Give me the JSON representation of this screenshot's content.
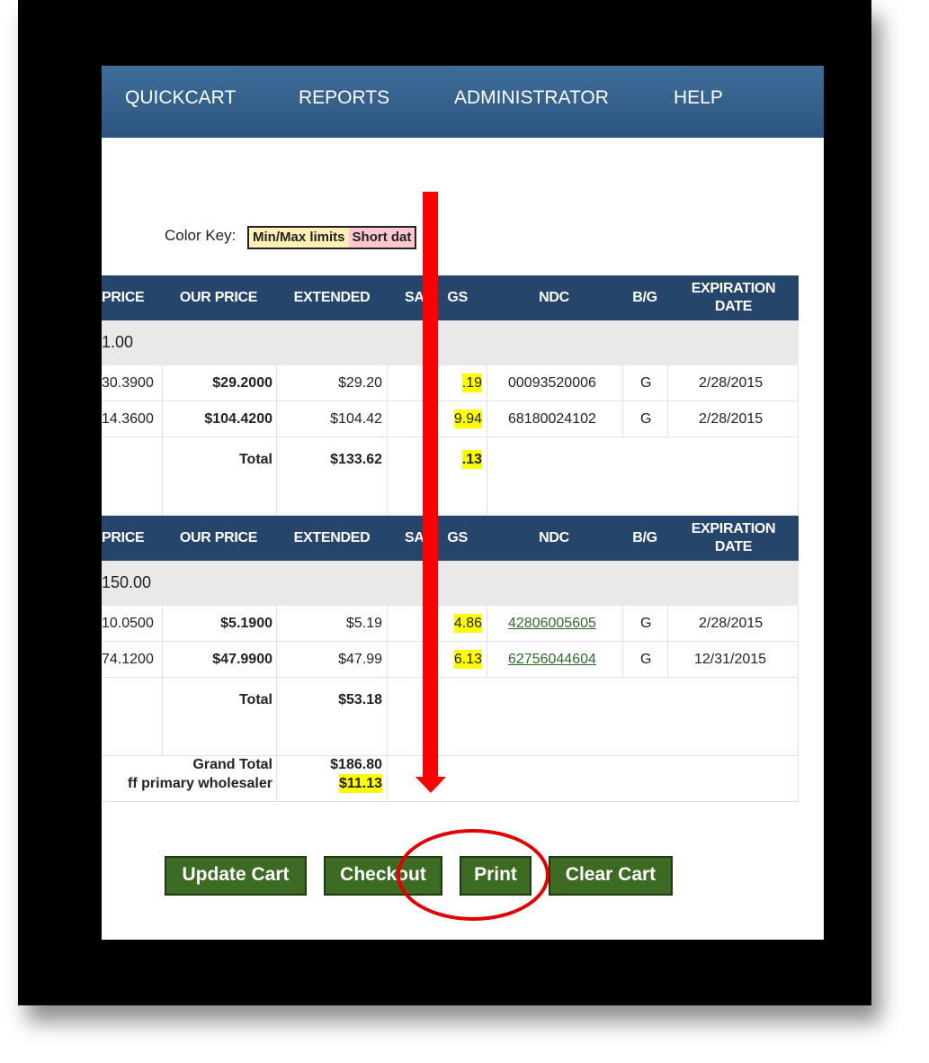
{
  "nav": {
    "items": [
      "QUICKCART",
      "REPORTS",
      "ADMINISTRATOR",
      "HELP"
    ]
  },
  "color_key": {
    "label": "Color Key:",
    "min_max": "Min/Max limits",
    "short_date": "Short dat"
  },
  "columns": {
    "price": "PRICE",
    "our_price": "OUR PRICE",
    "extended": "EXTENDED",
    "savings": "SAVI   GS",
    "ndc": "NDC",
    "bg": "B/G",
    "expiration_line1": "EXPIRATION",
    "expiration_line2": "DATE"
  },
  "sections": [
    {
      "group_value": "1.00",
      "rows": [
        {
          "price": "30.3900",
          "our_price": "$29.2000",
          "extended": "$29.20",
          "savings": ".19",
          "ndc": "00093520006",
          "bg": "G",
          "expiration": "2/28/2015"
        },
        {
          "price": "14.3600",
          "our_price": "$104.4200",
          "extended": "$104.42",
          "savings": "9.94",
          "ndc": "68180024102",
          "bg": "G",
          "expiration": "2/28/2015"
        }
      ],
      "total_label": "Total",
      "total_extended": "$133.62",
      "total_savings": ".13"
    },
    {
      "group_value": "150.00",
      "rows": [
        {
          "price": "10.0500",
          "our_price": "$5.1900",
          "extended": "$5.19",
          "savings": "4.86",
          "ndc": "42806005605",
          "bg": "G",
          "expiration": "2/28/2015"
        },
        {
          "price": "74.1200",
          "our_price": "$47.9900",
          "extended": "$47.99",
          "savings": "6.13",
          "ndc": "62756044604",
          "bg": "G",
          "expiration": "12/31/2015"
        }
      ],
      "total_label": "Total",
      "total_extended": "$53.18"
    }
  ],
  "grand_total": {
    "label": "Grand Total",
    "savings_label": "ff primary wholesaler",
    "extended": "$186.80",
    "savings": "$11.13"
  },
  "buttons": {
    "update_cart": "Update Cart",
    "checkout": "Checkout",
    "print": "Print",
    "clear_cart": "Clear Cart"
  },
  "colors": {
    "nav_bg": "#2b557f",
    "header_bg": "#25456a",
    "button_bg": "#3e6b24",
    "highlight": "#ffff00",
    "annotation": "#ff0000"
  }
}
